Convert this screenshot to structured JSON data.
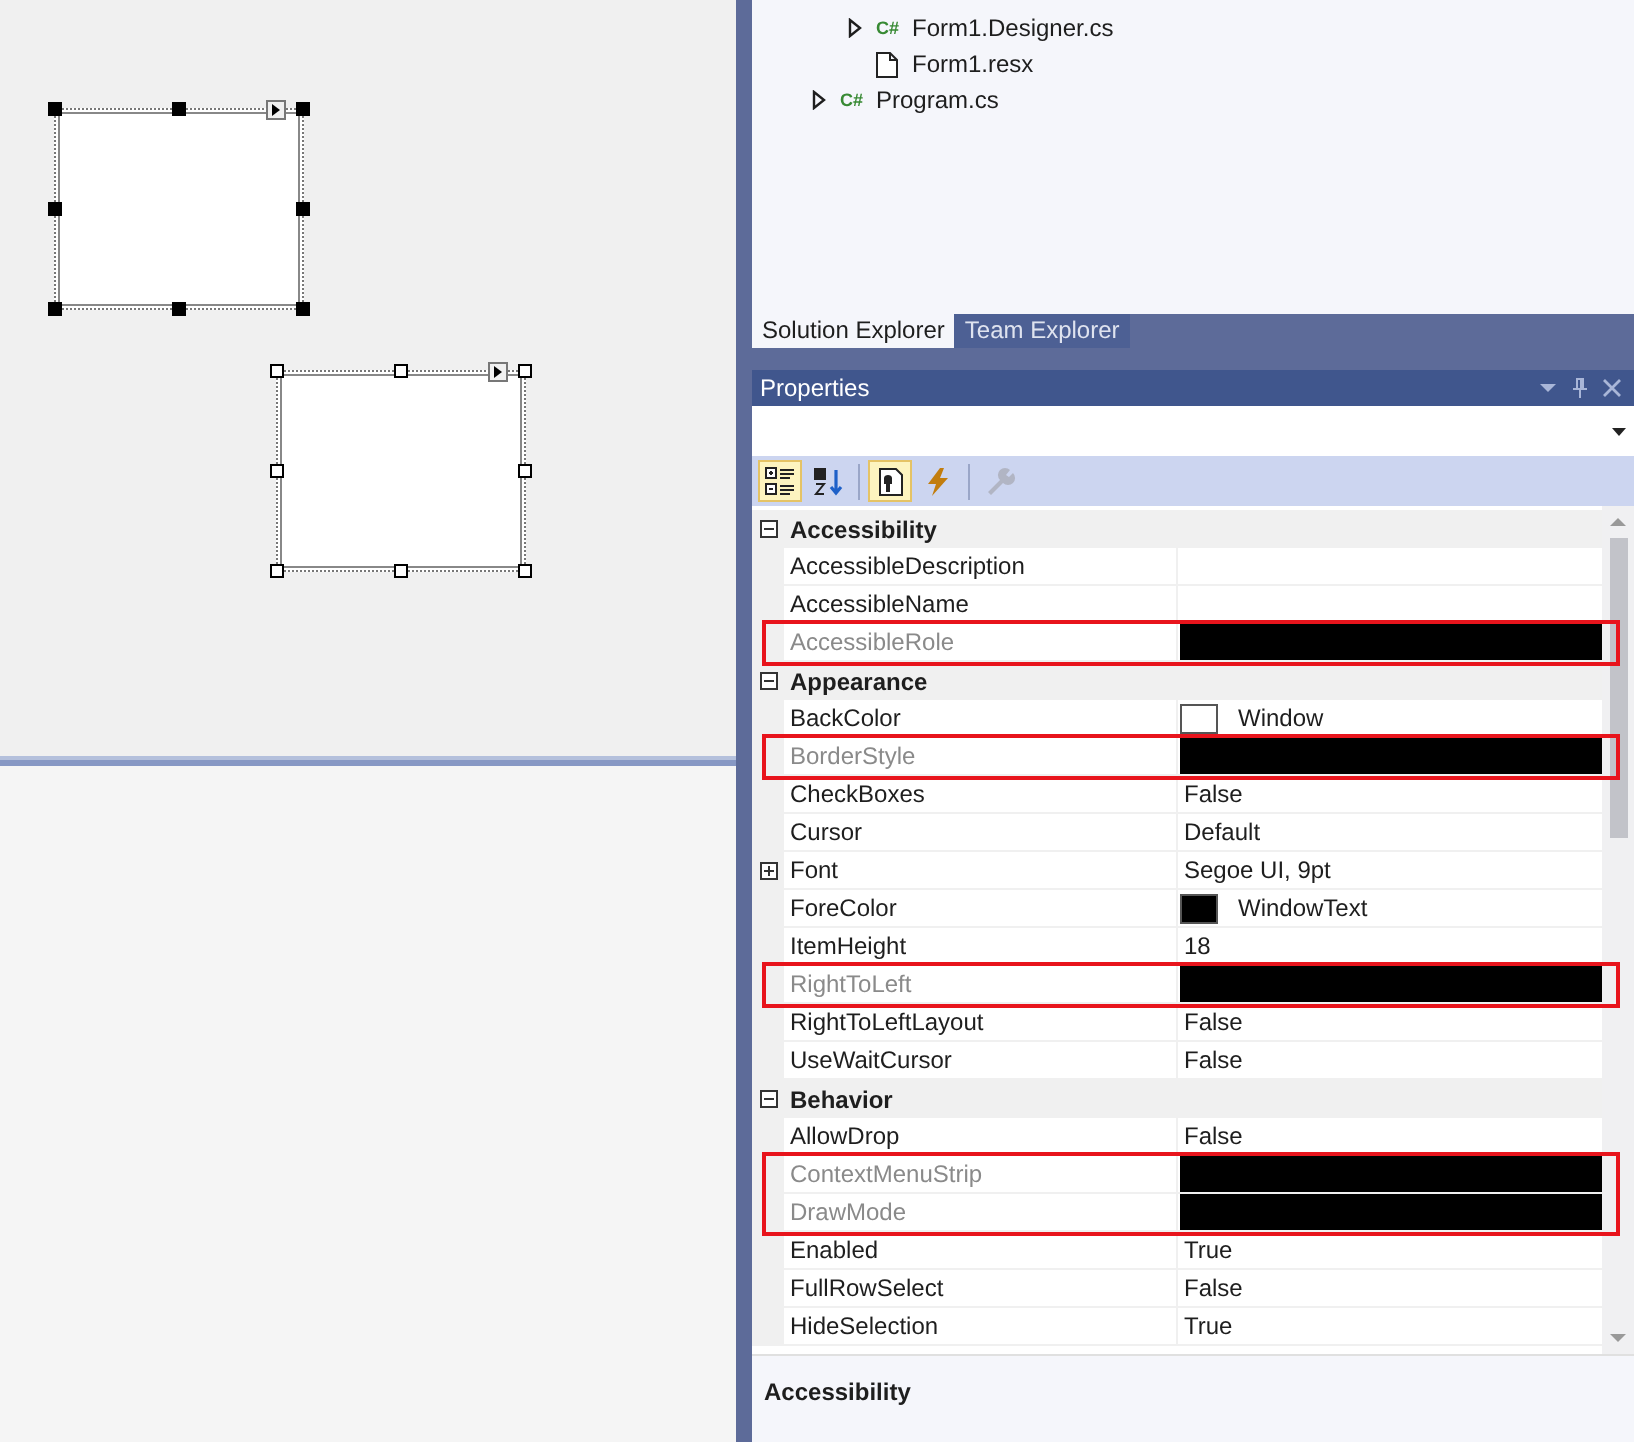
{
  "designer": {
    "controls": [
      {
        "kind": "listbox",
        "primary": true
      },
      {
        "kind": "listbox",
        "primary": false
      }
    ]
  },
  "solution_explorer": {
    "items": [
      {
        "children": [
          {
            "label": "Form1.Designer.cs",
            "kind": "code",
            "badge": "C#",
            "expandable": true,
            "expanded": false
          },
          {
            "label": "Form1.resx",
            "kind": "resource",
            "expandable": false
          }
        ]
      },
      {
        "label": "Program.cs",
        "kind": "code",
        "badge": "C#",
        "expandable": true,
        "expanded": false
      }
    ]
  },
  "tabs": [
    {
      "label": "Solution Explorer",
      "selected": true
    },
    {
      "label": "Team Explorer",
      "selected": false
    }
  ],
  "properties": {
    "title": "Properties",
    "toolbar": [
      {
        "kind": "categorized",
        "selected": true,
        "disabled": false
      },
      {
        "kind": "alphabetical",
        "selected": false,
        "disabled": false
      },
      {
        "kind": "properties",
        "selected": true,
        "disabled": false
      },
      {
        "kind": "events",
        "selected": false,
        "disabled": false
      },
      {
        "kind": "property-pages",
        "selected": false,
        "disabled": true
      }
    ],
    "categories": [
      {
        "name": "Accessibility",
        "expanded": true,
        "rows": [
          {
            "name": "AccessibleDescription",
            "readonly": false,
            "redacted": false,
            "highlighted": false
          },
          {
            "name": "AccessibleName",
            "readonly": false,
            "redacted": false,
            "highlighted": false
          },
          {
            "name": "AccessibleRole",
            "readonly": true,
            "redacted": true,
            "highlighted": true
          }
        ]
      },
      {
        "name": "Appearance",
        "expanded": true,
        "rows": [
          {
            "name": "BackColor",
            "value": "Window",
            "color": "#ffffff",
            "readonly": false,
            "redacted": false,
            "highlighted": false
          },
          {
            "name": "BorderStyle",
            "readonly": true,
            "redacted": true,
            "highlighted": true
          },
          {
            "name": "CheckBoxes",
            "value": "False",
            "readonly": false,
            "redacted": false,
            "highlighted": false
          },
          {
            "name": "Cursor",
            "value": "Default",
            "readonly": false,
            "redacted": false,
            "highlighted": false
          },
          {
            "name": "Font",
            "value": "Segoe UI, 9pt",
            "expandable": true,
            "expanded": false,
            "readonly": false,
            "redacted": false,
            "highlighted": false
          },
          {
            "name": "ForeColor",
            "value": "WindowText",
            "color": "#000000",
            "readonly": false,
            "redacted": false,
            "highlighted": false
          },
          {
            "name": "ItemHeight",
            "value": "18",
            "readonly": false,
            "redacted": false,
            "highlighted": false
          },
          {
            "name": "RightToLeft",
            "readonly": true,
            "redacted": true,
            "highlighted": true
          },
          {
            "name": "RightToLeftLayout",
            "value": "False",
            "readonly": false,
            "redacted": false,
            "highlighted": false
          },
          {
            "name": "UseWaitCursor",
            "value": "False",
            "readonly": false,
            "redacted": false,
            "highlighted": false
          }
        ]
      },
      {
        "name": "Behavior",
        "expanded": true,
        "rows": [
          {
            "name": "AllowDrop",
            "value": "False",
            "readonly": false,
            "redacted": false,
            "highlighted": false
          },
          {
            "name": "ContextMenuStrip",
            "readonly": true,
            "redacted": true,
            "highlighted": true
          },
          {
            "name": "DrawMode",
            "readonly": true,
            "redacted": true,
            "highlighted": true
          },
          {
            "name": "Enabled",
            "value": "True",
            "readonly": false,
            "redacted": false,
            "highlighted": false
          },
          {
            "name": "FullRowSelect",
            "value": "False",
            "readonly": false,
            "redacted": false,
            "highlighted": false
          },
          {
            "name": "HideSelection",
            "value": "True",
            "readonly": false,
            "redacted": false,
            "highlighted": false
          }
        ]
      }
    ],
    "description": {
      "title": "Accessibility"
    }
  }
}
